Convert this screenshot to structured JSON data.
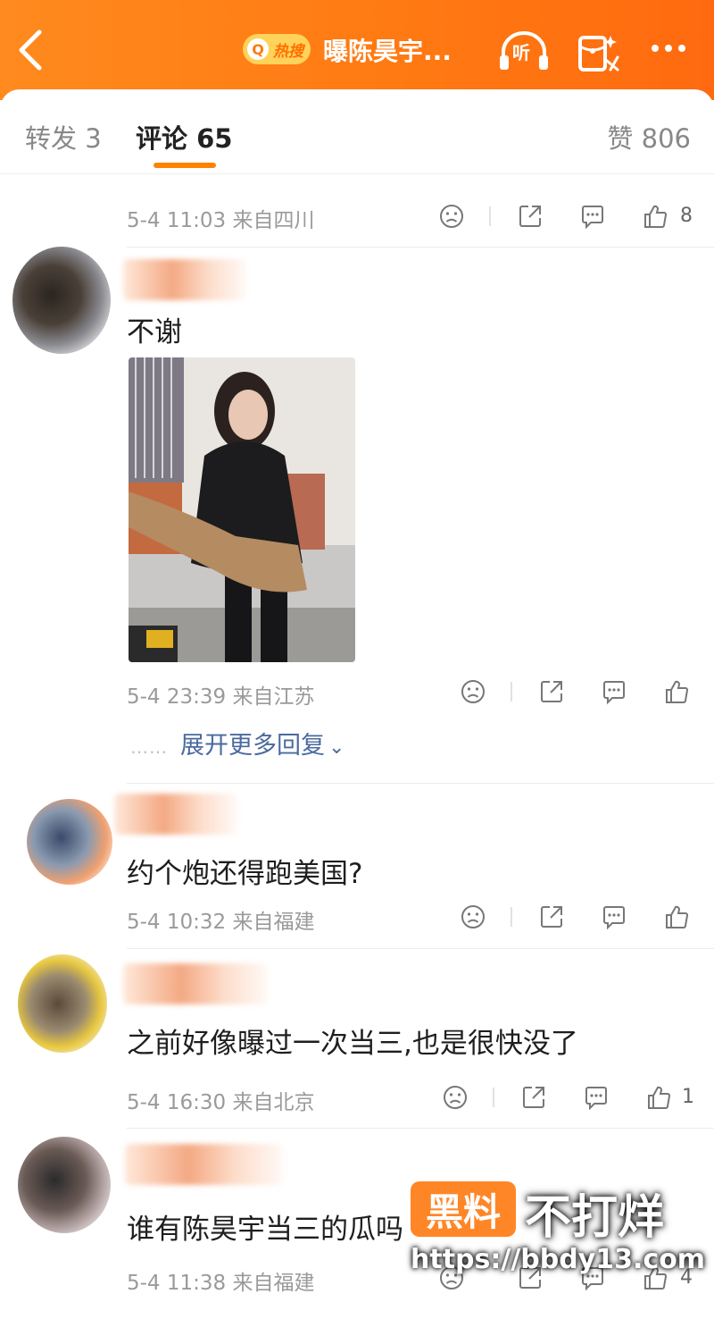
{
  "header": {
    "back_icon": "chevron-left-icon",
    "hot_badge_q": "Q",
    "hot_badge_text": "热搜",
    "title": "曝陈昊宇...",
    "listen_label": "听",
    "accent_color": "#ff7a12"
  },
  "tabs": {
    "repost": "转发 3",
    "comment": "评论 65",
    "like": "赞 806"
  },
  "first_meta": {
    "meta": "5-4 11:03 来自四川",
    "like_count": "8"
  },
  "comments": [
    {
      "text": "不谢",
      "meta": "5-4 23:39 来自江苏",
      "like_count": "",
      "has_image": true
    },
    {
      "text": "约个炮还得跑美国?",
      "meta": "5-4 10:32 来自福建",
      "like_count": ""
    },
    {
      "text": "之前好像曝过一次当三,也是很快没了",
      "meta": "5-4 16:30 来自北京",
      "like_count": "1"
    },
    {
      "text": "谁有陈昊宇当三的瓜吗",
      "meta": "5-4 11:38 来自福建",
      "like_count": "4"
    }
  ],
  "expand": {
    "dots": "……",
    "label": "展开更多回复",
    "chevron": "⌄"
  },
  "watermark": {
    "box": "黑料",
    "text": "不打烊",
    "url": "https://bbdy13.com"
  }
}
